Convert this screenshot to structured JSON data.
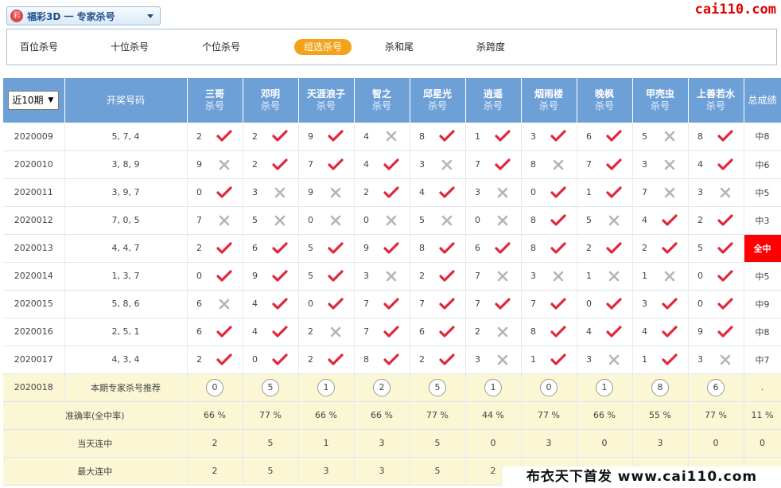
{
  "header": {
    "lottery_title": "福彩3D 一 专家杀号",
    "logo_icon": "lottery-logo-icon",
    "brand": "cai110.com"
  },
  "tabs": [
    {
      "label": "百位杀号",
      "active": false
    },
    {
      "label": "十位杀号",
      "active": false
    },
    {
      "label": "个位杀号",
      "active": false
    },
    {
      "label": "组选杀号",
      "active": true
    },
    {
      "label": "杀和尾",
      "active": false
    },
    {
      "label": "杀跨度",
      "active": false
    }
  ],
  "table": {
    "period_select": "近10期",
    "draw_col_label": "开奖号码",
    "total_col_label": "总成绩",
    "expert_sub": "杀号",
    "experts": [
      "三哥",
      "邓明",
      "天涯浪子",
      "智之",
      "邱星光",
      "逍遥",
      "烟雨楼",
      "晚枫",
      "甲壳虫",
      "上善若水"
    ],
    "rows": [
      {
        "issue": "2020009",
        "draw": "5, 7, 4",
        "picks": [
          [
            "2",
            1
          ],
          [
            "2",
            1
          ],
          [
            "9",
            1
          ],
          [
            "4",
            0
          ],
          [
            "8",
            1
          ],
          [
            "1",
            1
          ],
          [
            "3",
            1
          ],
          [
            "6",
            1
          ],
          [
            "5",
            0
          ],
          [
            "8",
            1
          ]
        ],
        "total": "中8"
      },
      {
        "issue": "2020010",
        "draw": "3, 8, 9",
        "picks": [
          [
            "9",
            0
          ],
          [
            "2",
            1
          ],
          [
            "7",
            1
          ],
          [
            "4",
            1
          ],
          [
            "3",
            0
          ],
          [
            "7",
            1
          ],
          [
            "8",
            0
          ],
          [
            "7",
            1
          ],
          [
            "3",
            0
          ],
          [
            "4",
            1
          ]
        ],
        "total": "中6"
      },
      {
        "issue": "2020011",
        "draw": "3, 9, 7",
        "picks": [
          [
            "0",
            1
          ],
          [
            "3",
            0
          ],
          [
            "9",
            0
          ],
          [
            "2",
            1
          ],
          [
            "4",
            1
          ],
          [
            "3",
            0
          ],
          [
            "0",
            1
          ],
          [
            "1",
            1
          ],
          [
            "7",
            0
          ],
          [
            "3",
            0
          ]
        ],
        "total": "中5"
      },
      {
        "issue": "2020012",
        "draw": "7, 0, 5",
        "picks": [
          [
            "7",
            0
          ],
          [
            "5",
            0
          ],
          [
            "0",
            0
          ],
          [
            "0",
            0
          ],
          [
            "5",
            0
          ],
          [
            "0",
            0
          ],
          [
            "8",
            1
          ],
          [
            "5",
            0
          ],
          [
            "4",
            1
          ],
          [
            "2",
            1
          ]
        ],
        "total": "中3"
      },
      {
        "issue": "2020013",
        "draw": "4, 4, 7",
        "picks": [
          [
            "2",
            1
          ],
          [
            "6",
            1
          ],
          [
            "5",
            1
          ],
          [
            "9",
            1
          ],
          [
            "8",
            1
          ],
          [
            "6",
            1
          ],
          [
            "8",
            1
          ],
          [
            "2",
            1
          ],
          [
            "2",
            1
          ],
          [
            "5",
            1
          ]
        ],
        "total": "全中"
      },
      {
        "issue": "2020014",
        "draw": "1, 3, 7",
        "picks": [
          [
            "0",
            1
          ],
          [
            "9",
            1
          ],
          [
            "5",
            1
          ],
          [
            "3",
            0
          ],
          [
            "2",
            1
          ],
          [
            "7",
            0
          ],
          [
            "3",
            0
          ],
          [
            "1",
            0
          ],
          [
            "1",
            0
          ],
          [
            "0",
            1
          ]
        ],
        "total": "中5"
      },
      {
        "issue": "2020015",
        "draw": "5, 8, 6",
        "picks": [
          [
            "6",
            0
          ],
          [
            "4",
            1
          ],
          [
            "0",
            1
          ],
          [
            "7",
            1
          ],
          [
            "7",
            1
          ],
          [
            "7",
            1
          ],
          [
            "7",
            1
          ],
          [
            "0",
            1
          ],
          [
            "3",
            1
          ],
          [
            "0",
            1
          ]
        ],
        "total": "中9"
      },
      {
        "issue": "2020016",
        "draw": "2, 5, 1",
        "picks": [
          [
            "6",
            1
          ],
          [
            "4",
            1
          ],
          [
            "2",
            0
          ],
          [
            "7",
            1
          ],
          [
            "6",
            1
          ],
          [
            "2",
            0
          ],
          [
            "8",
            1
          ],
          [
            "4",
            1
          ],
          [
            "4",
            1
          ],
          [
            "9",
            1
          ]
        ],
        "total": "中8"
      },
      {
        "issue": "2020017",
        "draw": "4, 3, 4",
        "picks": [
          [
            "2",
            1
          ],
          [
            "0",
            1
          ],
          [
            "2",
            1
          ],
          [
            "8",
            1
          ],
          [
            "2",
            1
          ],
          [
            "3",
            0
          ],
          [
            "1",
            1
          ],
          [
            "3",
            0
          ],
          [
            "1",
            1
          ],
          [
            "3",
            0
          ]
        ],
        "total": "中7"
      }
    ],
    "recommend": {
      "issue": "2020018",
      "label": "本期专家杀号推荐",
      "numbers": [
        "0",
        "5",
        "1",
        "2",
        "5",
        "1",
        "0",
        "1",
        "8",
        "6"
      ],
      "total": "."
    },
    "accuracy": {
      "label": "准确率(全中率)",
      "values": [
        "66 %",
        "77 %",
        "66 %",
        "66 %",
        "77 %",
        "44 %",
        "77 %",
        "66 %",
        "55 %",
        "77 %"
      ],
      "total": "11 %"
    },
    "streak_current": {
      "label": "当天连中",
      "values": [
        "2",
        "5",
        "1",
        "3",
        "5",
        "0",
        "3",
        "0",
        "3",
        "0"
      ],
      "total": "0"
    },
    "streak_max": {
      "label": "最大连中",
      "values": [
        "2",
        "5",
        "3",
        "3",
        "5",
        "2",
        "",
        "",
        "",
        ""
      ],
      "total": ""
    }
  },
  "footer_banner": "布衣天下首发 www.cai110.com",
  "colors": {
    "header_blue": "#6ea0d8",
    "check_red": "#e0283c",
    "cross_gray": "#b5b5b5",
    "active_tab": "#f3a21a",
    "all_hit": "#ff0000"
  }
}
